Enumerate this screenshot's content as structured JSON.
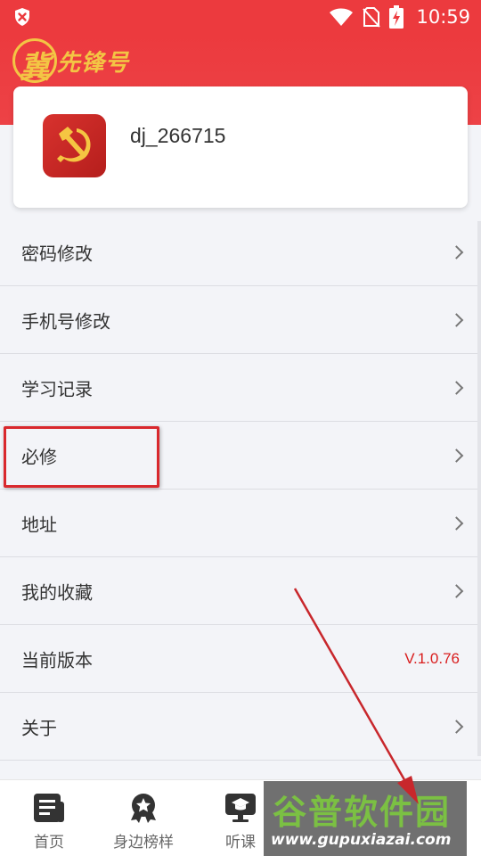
{
  "status": {
    "time": "10:59"
  },
  "app": {
    "logo_first": "冀",
    "logo_rest": "先锋号"
  },
  "profile": {
    "username": "dj_266715"
  },
  "menu": [
    {
      "label": "密码修改"
    },
    {
      "label": "手机号修改"
    },
    {
      "label": "学习记录"
    },
    {
      "label": "必修"
    },
    {
      "label": "地址"
    },
    {
      "label": "我的收藏"
    },
    {
      "label": "当前版本",
      "value": "V.1.0.76"
    },
    {
      "label": "关于"
    }
  ],
  "tabs": [
    {
      "label": "首页",
      "icon": "news-icon"
    },
    {
      "label": "身边榜样",
      "icon": "badge-icon"
    },
    {
      "label": "听课",
      "icon": "lecture-icon"
    }
  ],
  "watermark": {
    "title": "谷普软件园",
    "url": "www.gupuxiazai.com"
  },
  "colors": {
    "header": "#ec3a3e",
    "accent": "#d91e1e",
    "highlight": "#d9282d"
  }
}
